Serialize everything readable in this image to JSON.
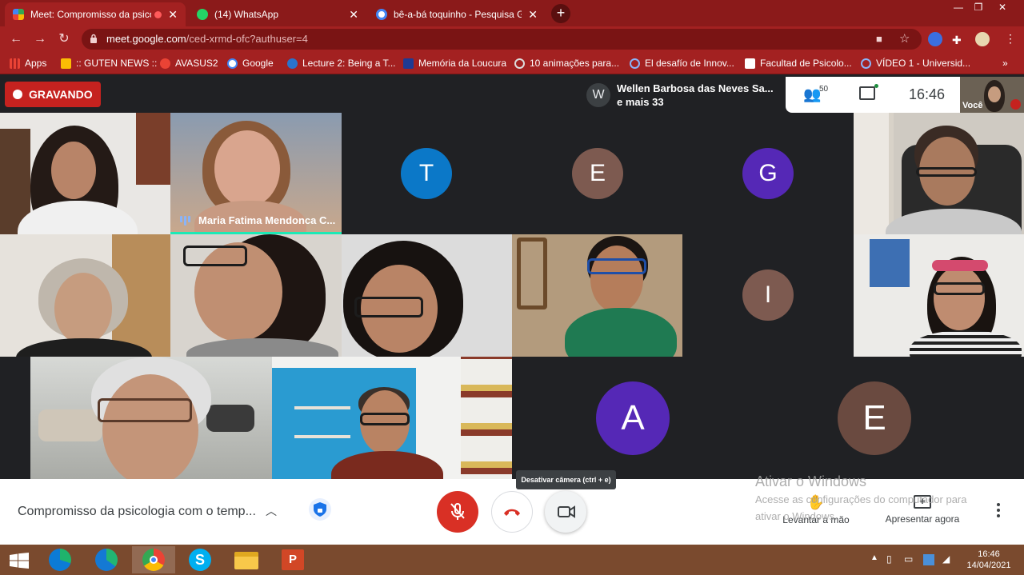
{
  "browser": {
    "tabs": [
      {
        "title": "Meet: Compromisso da psico",
        "active": true
      },
      {
        "title": "(14) WhatsApp",
        "active": false
      },
      {
        "title": "bê-a-bá toquinho - Pesquisa Goo",
        "active": false
      }
    ],
    "url_host": "meet.google.com",
    "url_path": "/ced-xrmd-ofc?authuser=4",
    "bookmarks": [
      "Apps",
      ":: GUTEN NEWS ::",
      "AVASUS2",
      "Google",
      "Lecture 2: Being a T...",
      "Memória da Loucura",
      "10 animações para...",
      "El desafío de Innov...",
      "Facultad de Psicolo...",
      "VÍDEO 1 - Universid..."
    ],
    "accent_color": "#a32121"
  },
  "meet": {
    "recording_label": "GRAVANDO",
    "presenter_avatar": "W",
    "presenter_line1": "Wellen Barbosa das Neves Sa...",
    "presenter_line2": "e mais 33",
    "participant_count": "50",
    "clock": "16:46",
    "self_label": "Você",
    "speaking_name": "Maria Fatima Mendonca C...",
    "avatar_tiles": [
      {
        "letter": "T",
        "color": "#0b78c8"
      },
      {
        "letter": "E",
        "color": "#7d5a50"
      },
      {
        "letter": "G",
        "color": "#5528b6"
      },
      {
        "letter": "I",
        "color": "#7d5a50"
      },
      {
        "letter": "A",
        "color": "#5528b6"
      },
      {
        "letter": "E",
        "color": "#6a4a40"
      }
    ],
    "meeting_title": "Compromisso da psicologia com o temp...",
    "tooltip": "Desativar câmera (ctrl + e)",
    "raise_hand_label": "Levantar a mão",
    "present_label": "Apresentar agora"
  },
  "windows": {
    "activate_title": "Ativar o Windows",
    "activate_line1": "Acesse as configurações do computador para",
    "activate_line2": "ativar o Windows.",
    "taskbar_time": "16:46",
    "taskbar_date": "14/04/2021"
  }
}
